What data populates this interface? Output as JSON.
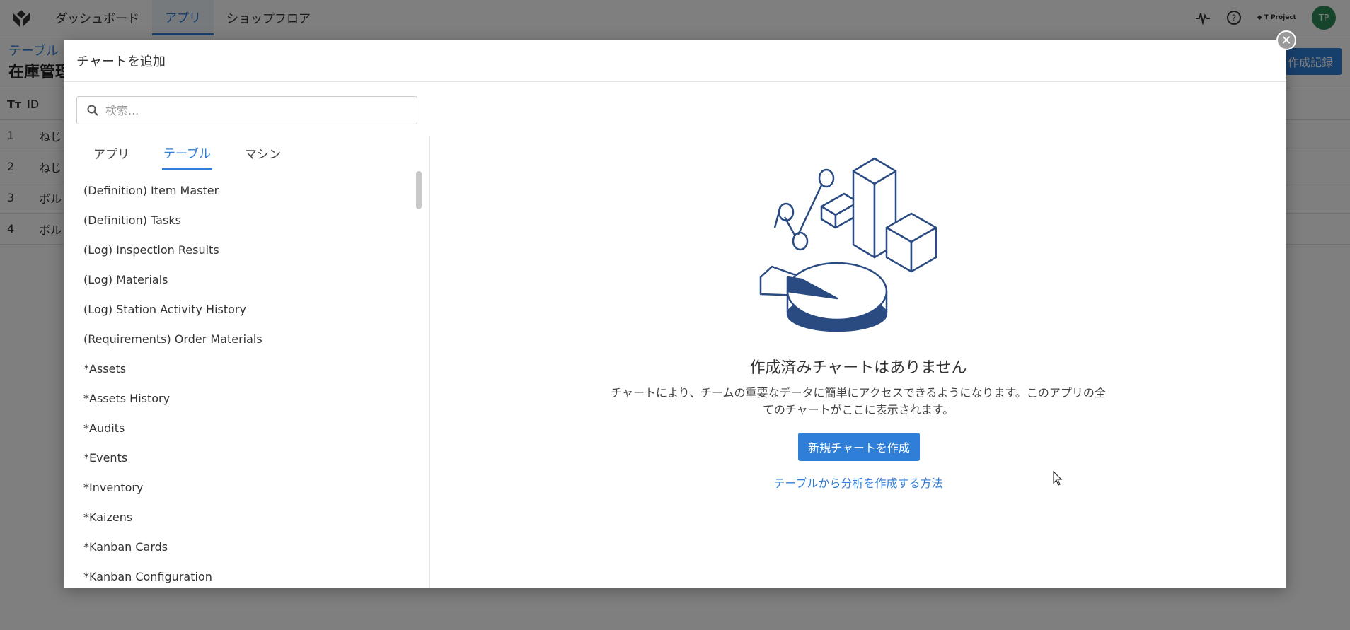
{
  "app": {
    "nav": [
      {
        "label": "ダッシュボード",
        "active": false
      },
      {
        "label": "アプリ",
        "active": true
      },
      {
        "label": "ショップフロア",
        "active": false
      }
    ],
    "project_label": "T Project",
    "avatar_initials": "TP"
  },
  "background": {
    "breadcrumb": "テーブル",
    "title": "在庫管理",
    "action_button": "作成記録",
    "column_header": "ID",
    "rows": [
      {
        "num": "1",
        "text": "ねじ"
      },
      {
        "num": "2",
        "text": "ねじ"
      },
      {
        "num": "3",
        "text": "ボル"
      },
      {
        "num": "4",
        "text": "ボル"
      }
    ]
  },
  "modal": {
    "title": "チャートを追加",
    "close_label": "✕",
    "search_placeholder": "検索...",
    "tabs": [
      {
        "label": "アプリ",
        "active": false
      },
      {
        "label": "テーブル",
        "active": true
      },
      {
        "label": "マシン",
        "active": false
      }
    ],
    "list_items": [
      "(Definition) Item Master",
      "(Definition) Tasks",
      "(Log) Inspection Results",
      "(Log) Materials",
      "(Log) Station Activity History",
      "(Requirements) Order Materials",
      "*Assets",
      "*Assets History",
      "*Audits",
      "*Events",
      "*Inventory",
      "*Kaizens",
      "*Kanban Cards",
      "*Kanban Configuration"
    ],
    "empty_state": {
      "title": "作成済みチャートはありません",
      "description": "チャートにより、チームの重要なデータに簡単にアクセスできるようになります。このアプリの全てのチャートがここに表示されます。",
      "create_button": "新規チャートを作成",
      "help_link": "テーブルから分析を作成する方法"
    }
  },
  "colors": {
    "accent": "#2f7fd8",
    "illustration": "#2a4a82",
    "avatar": "#2e8b57"
  }
}
